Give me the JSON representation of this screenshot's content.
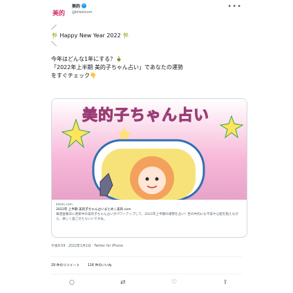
{
  "account": {
    "avatar_text": "美的",
    "name": "美的",
    "handle": "@bitekicom",
    "verified_badge": "✓",
    "more": "•••"
  },
  "tweet": {
    "line1": "／",
    "line2": "🎋 Happy New Year 2022 🎋",
    "line3": "＼",
    "line4": "今年はどんな1年にする？🎍",
    "line5": "「2022年上半期 美的子ちゃん占い」であなたの運勢",
    "line6": "をすぐチェック👇"
  },
  "card": {
    "image_title": "美的子ちゃん占い",
    "domain": "biteki.com",
    "title": "2022年 上半期 美的子ちゃん占いまとめ | 美的.com",
    "description": "毎週金曜日に更新中の美的子ちゃん占いがパワーアップして、2022年上半期の運勢を占い！世の中的にも不安や心配を抱えながら、楽しく過ごせたらいいですね。"
  },
  "footer": {
    "timestamp": "午後9:59 · 2022年1月1日 · Twitter for iPhone"
  },
  "stats": {
    "retweets": "29 件のリツイート",
    "likes": "116 件のいいね"
  },
  "actions": {
    "reply": "○",
    "retweet": "⇄",
    "like": "♡",
    "share": "⇪"
  }
}
